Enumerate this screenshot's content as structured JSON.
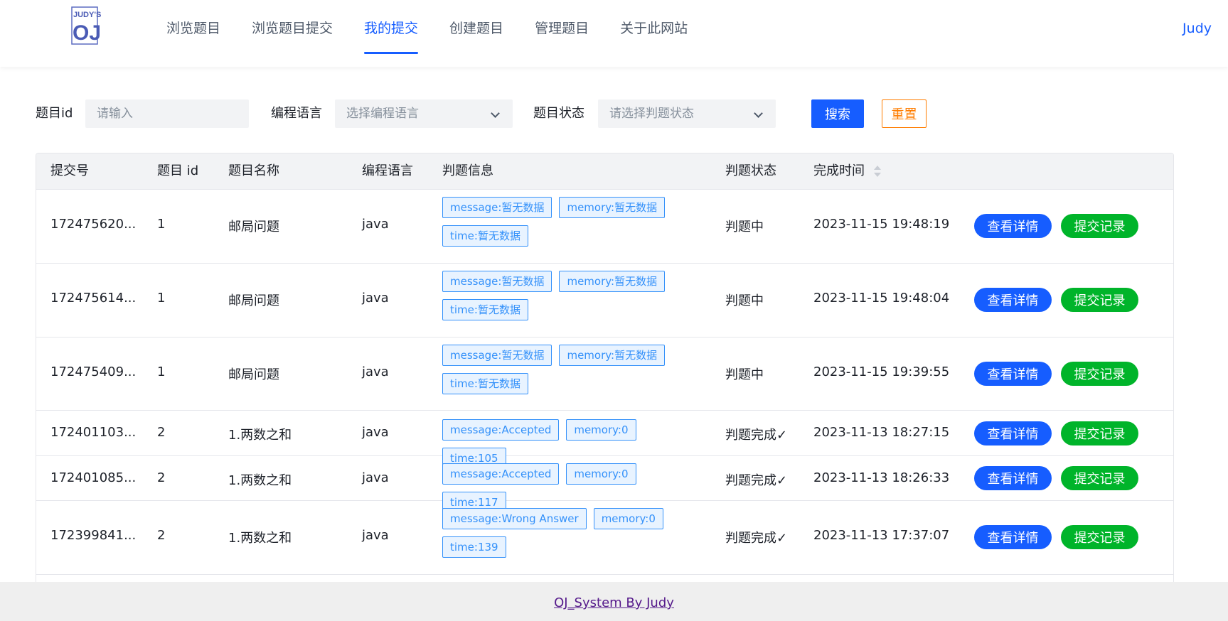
{
  "header": {
    "logo_text_top": "JUDY'S",
    "logo_text_main": "OJ",
    "nav": [
      {
        "label": "浏览题目",
        "active": false
      },
      {
        "label": "浏览题目提交",
        "active": false
      },
      {
        "label": "我的提交",
        "active": true
      },
      {
        "label": "创建题目",
        "active": false
      },
      {
        "label": "管理题目",
        "active": false
      },
      {
        "label": "关于此网站",
        "active": false
      }
    ],
    "user": "Judy"
  },
  "filters": {
    "question_id_label": "题目id",
    "question_id_placeholder": "请输入",
    "language_label": "编程语言",
    "language_placeholder": "选择编程语言",
    "status_label": "题目状态",
    "status_placeholder": "请选择判题状态",
    "search_button": "搜索",
    "reset_button": "重置"
  },
  "table": {
    "columns": [
      "提交号",
      "题目 id",
      "题目名称",
      "编程语言",
      "判题信息",
      "判题状态",
      "完成时间"
    ],
    "detail_button": "查看详情",
    "record_button": "提交记录",
    "rows": [
      {
        "id": "172475620...",
        "qid": "1",
        "name": "邮局问题",
        "lang": "java",
        "tags": [
          "message:暂无数据",
          "memory:暂无数据",
          "time:暂无数据"
        ],
        "status": "判题中",
        "time": "2023-11-15 19:48:19"
      },
      {
        "id": "172475614...",
        "qid": "1",
        "name": "邮局问题",
        "lang": "java",
        "tags": [
          "message:暂无数据",
          "memory:暂无数据",
          "time:暂无数据"
        ],
        "status": "判题中",
        "time": "2023-11-15 19:48:04"
      },
      {
        "id": "172475409...",
        "qid": "1",
        "name": "邮局问题",
        "lang": "java",
        "tags": [
          "message:暂无数据",
          "memory:暂无数据",
          "time:暂无数据"
        ],
        "status": "判题中",
        "time": "2023-11-15 19:39:55"
      },
      {
        "id": "172401103...",
        "qid": "2",
        "name": "1.两数之和",
        "lang": "java",
        "tags": [
          "message:Accepted",
          "memory:0",
          "time:105"
        ],
        "status": "判题完成✓",
        "time": "2023-11-13 18:27:15"
      },
      {
        "id": "172401085...",
        "qid": "2",
        "name": "1.两数之和",
        "lang": "java",
        "tags": [
          "message:Accepted",
          "memory:0",
          "time:117"
        ],
        "status": "判题完成✓",
        "time": "2023-11-13 18:26:33"
      },
      {
        "id": "172399841...",
        "qid": "2",
        "name": "1.两数之和",
        "lang": "java",
        "tags": [
          "message:Wrong Answer",
          "memory:0",
          "time:139"
        ],
        "status": "判题完成✓",
        "time": "2023-11-13 17:37:07"
      }
    ]
  },
  "footer": {
    "text": "OJ_System By Judy"
  },
  "colors": {
    "primary": "#165dff",
    "success": "#00b42a",
    "warning": "#ff7d00",
    "tag": "#3491fa"
  }
}
